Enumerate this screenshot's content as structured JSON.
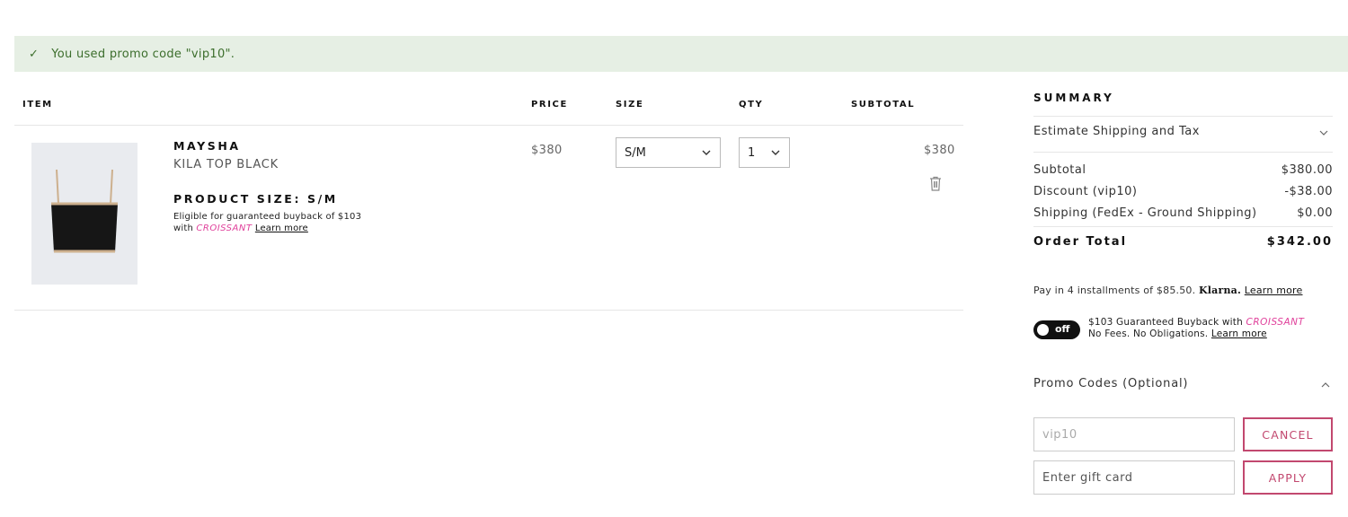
{
  "banner": {
    "check_glyph": "✓",
    "message": "You used promo code \"vip10\"."
  },
  "cart": {
    "headers": {
      "item": "ITEM",
      "price": "PRICE",
      "size": "SIZE",
      "qty": "QTY",
      "subtotal": "SUBTOTAL"
    },
    "items": [
      {
        "brand": "MAYSHA",
        "name": "KILA TOP BLACK",
        "size_label": "PRODUCT SIZE: S/M",
        "buyback_line1": "Eligible for guaranteed buyback of $103",
        "buyback_with": "with",
        "buyback_brand": "CROISSANT",
        "learn_more": "Learn more",
        "price": "$380",
        "size_value": "S/M",
        "qty_value": "1",
        "subtotal": "$380",
        "image_icon": "product-image"
      }
    ]
  },
  "summary": {
    "title": "SUMMARY",
    "estimate_shipping": "Estimate Shipping and Tax",
    "rows": [
      {
        "label": "Subtotal",
        "value": "$380.00"
      },
      {
        "label": "Discount (vip10)",
        "value": "-$38.00"
      },
      {
        "label": "Shipping (FedEx - Ground Shipping)",
        "value": "$0.00"
      }
    ],
    "order_total_label": "Order Total",
    "order_total_value": "$342.00",
    "klarna": {
      "text": "Pay in 4 installments of $85.50.",
      "brand": "Klarna.",
      "learn_more": "Learn more"
    },
    "buyback": {
      "toggle_label": "off",
      "line1": "$103 Guaranteed Buyback with",
      "brand": "CROISSANT",
      "line2": "No Fees. No Obligations.",
      "learn_more": "Learn more"
    },
    "promo": {
      "heading": "Promo Codes (Optional)",
      "code_value": "vip10",
      "cancel_label": "CANCEL",
      "gift_placeholder": "Enter gift card",
      "apply_label": "APPLY"
    }
  },
  "colors": {
    "banner_bg": "#e6efe4",
    "banner_text": "#3c6e2c",
    "accent": "#c2486f",
    "croissant": "#e0409b"
  }
}
